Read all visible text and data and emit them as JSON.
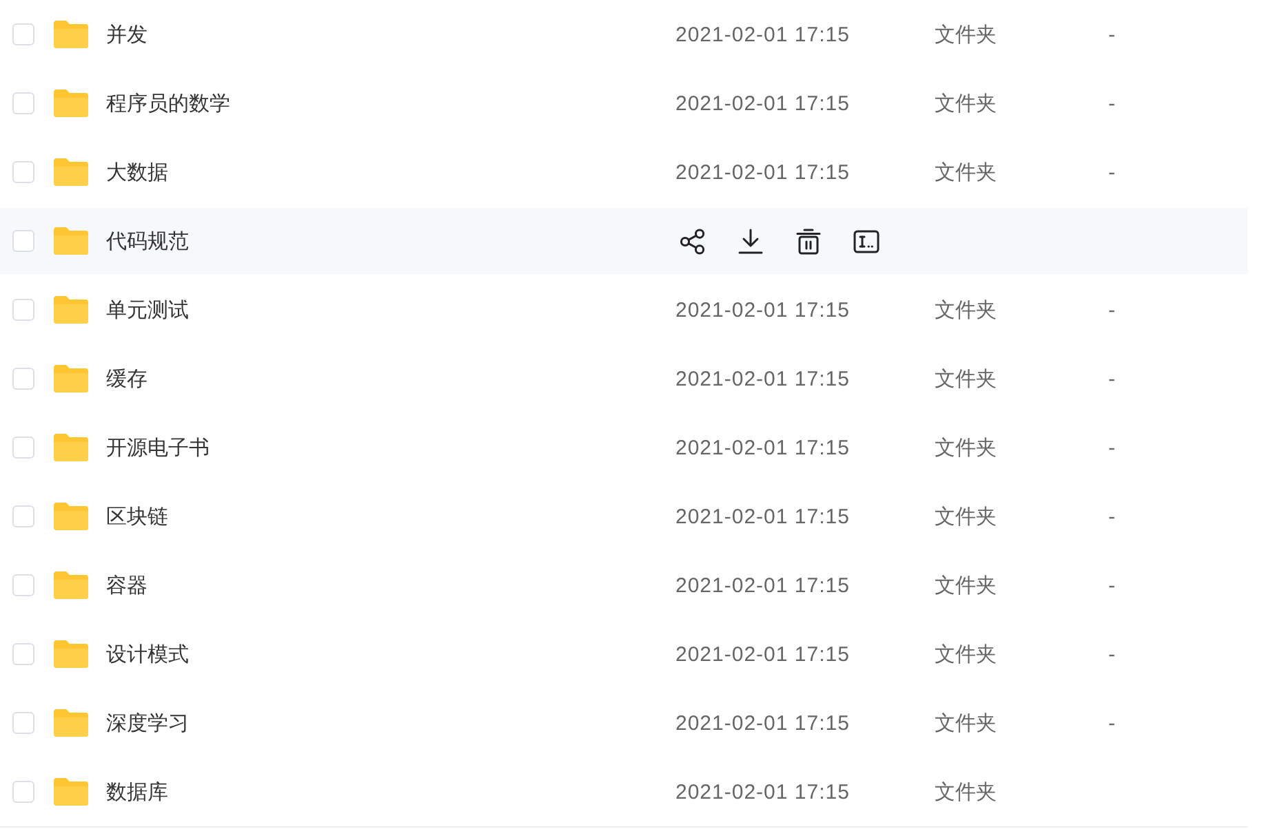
{
  "rows": [
    {
      "name": "并发",
      "date": "2021-02-01 17:15",
      "type": "文件夹",
      "size": "-",
      "checked": false,
      "hovered": false
    },
    {
      "name": "程序员的数学",
      "date": "2021-02-01 17:15",
      "type": "文件夹",
      "size": "-",
      "checked": false,
      "hovered": false
    },
    {
      "name": "大数据",
      "date": "2021-02-01 17:15",
      "type": "文件夹",
      "size": "-",
      "checked": false,
      "hovered": false
    },
    {
      "name": "代码规范",
      "checked": false,
      "hovered": true
    },
    {
      "name": "单元测试",
      "date": "2021-02-01 17:15",
      "type": "文件夹",
      "size": "-",
      "checked": false,
      "hovered": false
    },
    {
      "name": "缓存",
      "date": "2021-02-01 17:15",
      "type": "文件夹",
      "size": "-",
      "checked": false,
      "hovered": false
    },
    {
      "name": "开源电子书",
      "date": "2021-02-01 17:15",
      "type": "文件夹",
      "size": "-",
      "checked": false,
      "hovered": false
    },
    {
      "name": "区块链",
      "date": "2021-02-01 17:15",
      "type": "文件夹",
      "size": "-",
      "checked": false,
      "hovered": false
    },
    {
      "name": "容器",
      "date": "2021-02-01 17:15",
      "type": "文件夹",
      "size": "-",
      "checked": false,
      "hovered": false
    },
    {
      "name": "设计模式",
      "date": "2021-02-01 17:15",
      "type": "文件夹",
      "size": "-",
      "checked": false,
      "hovered": false
    },
    {
      "name": "深度学习",
      "date": "2021-02-01 17:15",
      "type": "文件夹",
      "size": "-",
      "checked": false,
      "hovered": false
    },
    {
      "name": "数据库",
      "date": "2021-02-01 17:15",
      "type": "文件夹",
      "checked": false,
      "hovered": false
    }
  ]
}
